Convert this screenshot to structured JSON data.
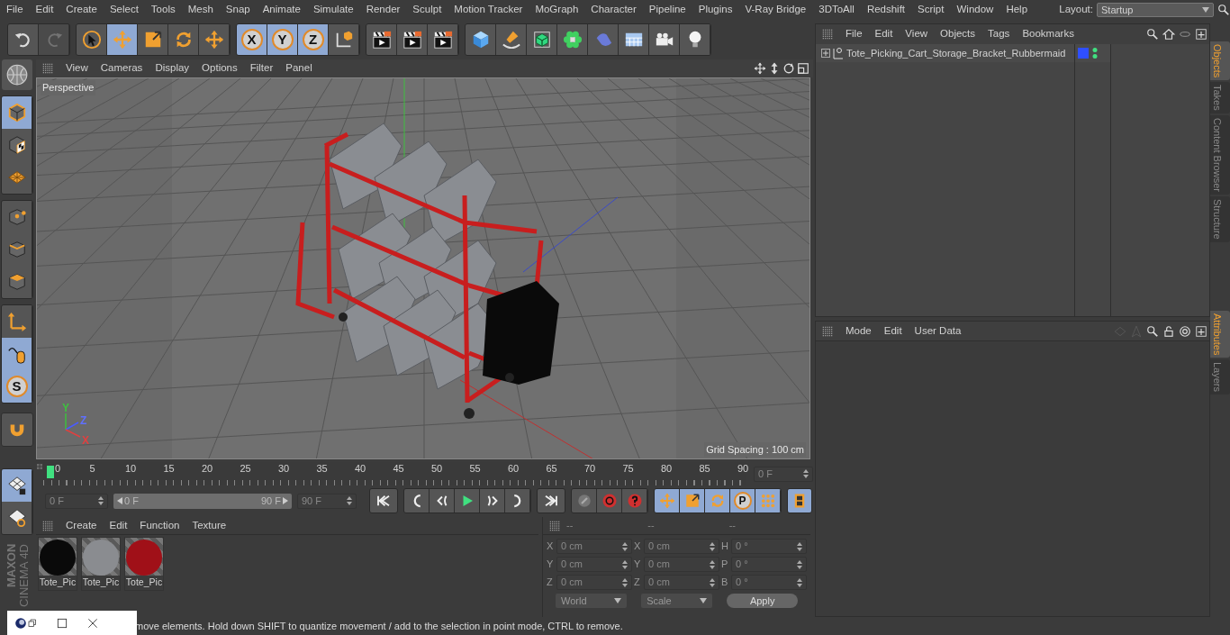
{
  "menu_bar": {
    "items": [
      "File",
      "Edit",
      "Create",
      "Select",
      "Tools",
      "Mesh",
      "Snap",
      "Animate",
      "Simulate",
      "Render",
      "Sculpt",
      "Motion Tracker",
      "MoGraph",
      "Character",
      "Pipeline",
      "Plugins",
      "V-Ray Bridge",
      "3DToAll",
      "Redshift",
      "Script",
      "Window",
      "Help"
    ],
    "layout_label": "Layout:",
    "layout_value": "Startup"
  },
  "toolbar": {
    "groups": [
      [
        {
          "selected": false,
          "disabled": false
        },
        {
          "selected": false,
          "disabled": true
        }
      ],
      [
        {
          "selected": false
        },
        {
          "selected": true
        },
        {
          "selected": false
        },
        {
          "selected": false
        },
        {
          "selected": false
        }
      ],
      [
        {
          "label": "X",
          "selected": true
        },
        {
          "label": "Y",
          "selected": true
        },
        {
          "label": "Z",
          "selected": true
        },
        {
          "selected": false
        }
      ],
      [
        {
          "selected": false
        },
        {
          "selected": false
        },
        {
          "selected": false
        }
      ],
      [
        {
          "selected": false
        },
        {
          "selected": false
        },
        {
          "selected": false
        },
        {
          "selected": false
        },
        {
          "selected": false
        },
        {
          "selected": false
        },
        {
          "selected": false
        },
        {
          "selected": false
        }
      ]
    ]
  },
  "left_toolbar": {
    "groups": [
      [
        {
          "selected": true
        },
        {
          "selected": false
        },
        {
          "selected": false
        }
      ],
      [
        {
          "selected": false
        },
        {
          "selected": false
        },
        {
          "selected": false
        }
      ],
      [
        {
          "selected": false
        },
        {
          "selected": true
        },
        {
          "label": "S",
          "selected": true
        }
      ],
      [
        {
          "selected": false
        }
      ],
      [
        {
          "selected": true
        },
        {
          "selected": false
        }
      ]
    ],
    "brand": "MAXON",
    "product": "CINEMA 4D"
  },
  "viewport": {
    "menu": [
      "View",
      "Cameras",
      "Display",
      "Options",
      "Filter",
      "Panel"
    ],
    "camera": "Perspective",
    "grid_spacing": "Grid Spacing : 100 cm",
    "gizmo_labels": [
      {
        "label": "Y",
        "color": "#3fbf3f"
      },
      {
        "label": "Z",
        "color": "#6070ff"
      },
      {
        "label": "X",
        "color": "#e04040"
      }
    ]
  },
  "timeline": {
    "ticks": [
      "0",
      "5",
      "10",
      "15",
      "20",
      "25",
      "30",
      "35",
      "40",
      "45",
      "50",
      "55",
      "60",
      "65",
      "70",
      "75",
      "80",
      "85",
      "90"
    ],
    "current_frame": "0 F",
    "start_frame": "0 F",
    "range_slider": {
      "start": "0 F",
      "end": "90 F",
      "level": 1
    },
    "end_frame": "90 F",
    "keyframe_modes": [
      {
        "selected": true
      },
      {
        "selected": true
      },
      {
        "selected": true
      },
      {
        "label": "P",
        "selected": true
      },
      {
        "selected": true
      }
    ]
  },
  "material_manager": {
    "menu": [
      "Create",
      "Edit",
      "Function",
      "Texture"
    ],
    "materials": [
      {
        "name": "Tote_Pic",
        "color": "#0a0a0a"
      },
      {
        "name": "Tote_Pic",
        "color": "#8a8c90"
      },
      {
        "name": "Tote_Pic",
        "color": "#a01018"
      }
    ]
  },
  "coordinates": {
    "headers": [
      "--",
      "--",
      "--"
    ],
    "columns": [
      [
        {
          "label": "X",
          "value": "0 cm"
        },
        {
          "label": "Y",
          "value": "0 cm"
        },
        {
          "label": "Z",
          "value": "0 cm"
        }
      ],
      [
        {
          "label": "X",
          "value": "0 cm"
        },
        {
          "label": "Y",
          "value": "0 cm"
        },
        {
          "label": "Z",
          "value": "0 cm"
        }
      ],
      [
        {
          "label": "H",
          "value": "0 °"
        },
        {
          "label": "P",
          "value": "0 °"
        },
        {
          "label": "B",
          "value": "0 °"
        }
      ]
    ],
    "space": "World",
    "mode": "Scale",
    "apply": "Apply"
  },
  "object_manager": {
    "menu": [
      "File",
      "Edit",
      "View",
      "Objects",
      "Tags",
      "Bookmarks"
    ],
    "objects": [
      {
        "name": "Tote_Picking_Cart_Storage_Bracket_Rubbermaid",
        "expanded": false,
        "color": "#2f4fff"
      }
    ]
  },
  "attributes": {
    "menu": [
      "Mode",
      "Edit",
      "User Data"
    ]
  },
  "side_tabs_top": [
    {
      "label": "Objects",
      "selected": true
    },
    {
      "label": "Takes",
      "selected": false
    },
    {
      "label": "Content Browser",
      "selected": false
    },
    {
      "label": "Structure",
      "selected": false
    }
  ],
  "side_tabs_bottom": [
    {
      "label": "Attributes",
      "selected": true
    },
    {
      "label": "Layers",
      "selected": false
    }
  ],
  "status_bar": "move elements. Hold down SHIFT to quantize movement / add to the selection in point mode, CTRL to remove."
}
